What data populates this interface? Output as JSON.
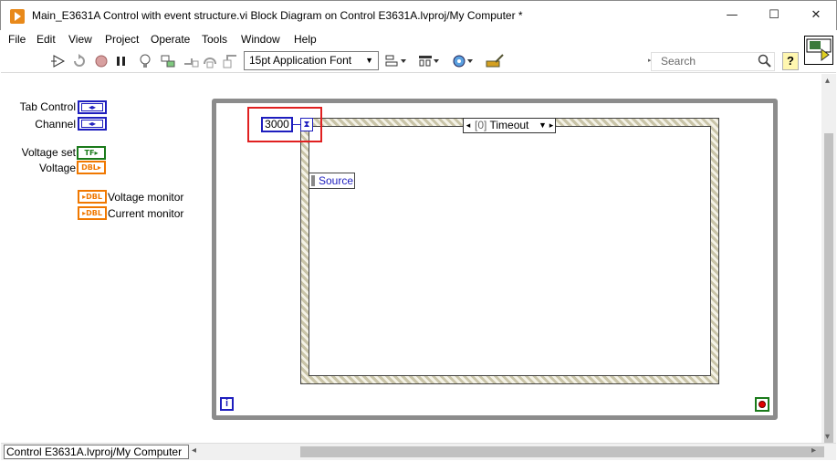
{
  "window": {
    "title": "Main_E3631A Control with event structure.vi Block Diagram on Control E3631A.lvproj/My Computer *",
    "minimize_glyph": "—",
    "maximize_glyph": "☐",
    "close_glyph": "✕"
  },
  "menu": [
    "File",
    "Edit",
    "View",
    "Project",
    "Operate",
    "Tools",
    "Window",
    "Help"
  ],
  "toolbar": {
    "font_select": "15pt Application Font",
    "search_placeholder": "Search",
    "help_label": "?",
    "icons": [
      "run-arrow-icon",
      "run-continuous-icon",
      "abort-icon",
      "pause-icon",
      "highlight-execution-icon",
      "retain-wire-values-icon",
      "step-into-icon",
      "step-over-icon",
      "step-out-icon",
      "align-objects-icon",
      "distribute-objects-icon",
      "reorder-icon",
      "cleanup-diagram-icon"
    ]
  },
  "terminals": [
    {
      "label": "Tab Control",
      "kind": "enum"
    },
    {
      "label": "Channel",
      "kind": "enum"
    },
    {
      "label": "Voltage set",
      "kind": "TF"
    },
    {
      "label": "Voltage",
      "kind": "DBL"
    },
    {
      "label": "Voltage monitor",
      "kind": "DBL"
    },
    {
      "label": "Current monitor",
      "kind": "DBL"
    }
  ],
  "diagram": {
    "timeout_constant": "3000",
    "event_case_index": "[0]",
    "event_case_name": "Timeout",
    "event_data_node": "Source",
    "iteration_label": "i"
  },
  "statusbar": {
    "path": "Control E3631A.lvproj/My Computer"
  },
  "colors": {
    "int_wire": "#1e1ebe",
    "bool_wire": "#1a7a1a",
    "dbl_wire": "#f07800",
    "highlight_box": "#e02020"
  }
}
